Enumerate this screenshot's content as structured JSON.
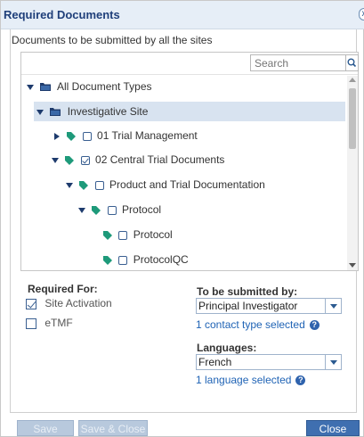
{
  "dialog": {
    "title": "Required Documents",
    "close_glyph": "x",
    "subtitle": "Documents to be submitted by all the sites"
  },
  "tree": {
    "search_placeholder": "Search",
    "nodes": [
      {
        "label": "All Document Types",
        "expanded": true,
        "icon": "folder-icon"
      },
      {
        "label": "Investigative Site",
        "expanded": true,
        "icon": "folder-icon",
        "selected": true
      },
      {
        "label": "01 Trial Management",
        "expanded": false,
        "icon": "tag-icon",
        "checked": false
      },
      {
        "label": "02 Central Trial Documents",
        "expanded": true,
        "icon": "tag-icon",
        "checked": true
      },
      {
        "label": "Product and Trial Documentation",
        "expanded": true,
        "icon": "tag-icon",
        "checked": false
      },
      {
        "label": "Protocol",
        "expanded": true,
        "icon": "tag-icon",
        "checked": false
      },
      {
        "label": "Protocol",
        "icon": "tag-icon",
        "checked": false
      },
      {
        "label": "ProtocolQC",
        "icon": "tag-icon",
        "checked": false
      }
    ]
  },
  "required_for": {
    "label": "Required For:",
    "options": [
      {
        "label": "Site Activation",
        "checked": true
      },
      {
        "label": "eTMF",
        "checked": false
      }
    ]
  },
  "submitted_by": {
    "label": "To be submitted by:",
    "value": "Principal Investigator",
    "count_text": "1 contact type selected"
  },
  "languages": {
    "label": "Languages:",
    "value": "French",
    "count_text": "1 language selected"
  },
  "buttons": {
    "save": "Save",
    "save_close": "Save & Close",
    "close": "Close"
  },
  "colors": {
    "accent": "#3f6fb0",
    "title_text": "#1f3f7a",
    "link": "#1f63b5",
    "tag": "#1e9a7a",
    "disabled_button": "#b8c9dd"
  }
}
